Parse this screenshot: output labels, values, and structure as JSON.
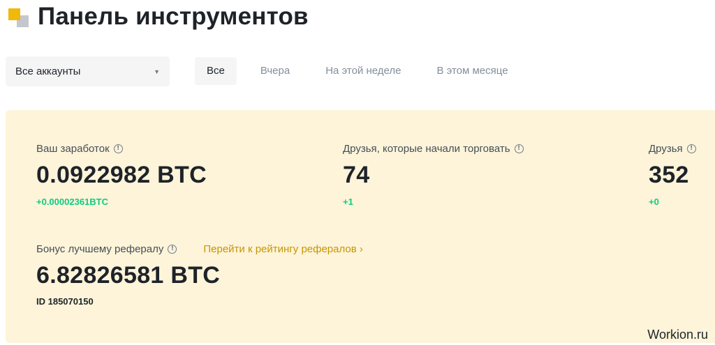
{
  "header": {
    "title": "Панель инструментов",
    "logo_icon": "brand-logo-icon"
  },
  "account_select": {
    "value": "Все аккаунты",
    "caret_icon": "chevron-down-icon"
  },
  "filters": [
    {
      "label": "Все",
      "active": true
    },
    {
      "label": "Вчера",
      "active": false
    },
    {
      "label": "На этой неделе",
      "active": false
    },
    {
      "label": "В этом месяце",
      "active": false
    }
  ],
  "stats": {
    "earnings": {
      "label": "Ваш заработок",
      "value": "0.0922982 BTC",
      "change": "+0.00002361BTC"
    },
    "trading_friends": {
      "label": "Друзья, которые начали торговать",
      "value": "74",
      "change": "+1"
    },
    "friends": {
      "label": "Друзья",
      "value": "352",
      "change": "+0"
    },
    "bonus": {
      "label": "Бонус лучшему рефералу",
      "link": "Перейти к рейтингу рефералов ›",
      "value": "6.82826581 BTC",
      "id": "ID 185070150"
    }
  },
  "info_icon_glyph": "!",
  "colors": {
    "accent": "#f0b90b",
    "panel": "#fdf4d9",
    "positive": "#0ecb81",
    "link": "#c99400"
  },
  "watermark": "Workion.ru"
}
